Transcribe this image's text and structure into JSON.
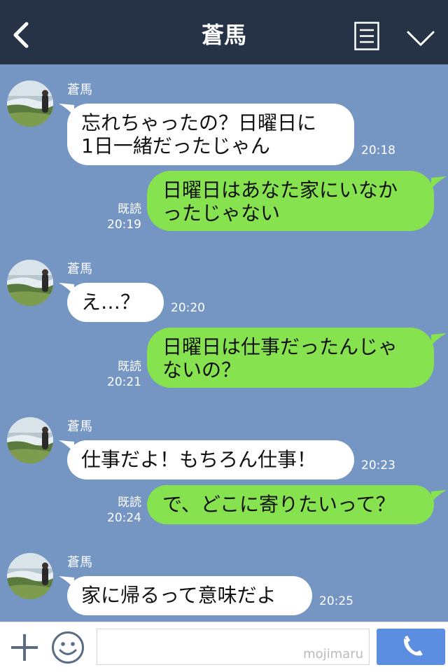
{
  "header": {
    "title": "蒼馬"
  },
  "messages": [
    {
      "side": "in",
      "name": "蒼馬",
      "lines": [
        "忘れちゃったの？日曜日に",
        "1日一緒だったじゃん"
      ],
      "time": "20:18"
    },
    {
      "side": "out",
      "read": "既読",
      "lines": [
        "日曜日はあなた家にいなか",
        "ったじゃない"
      ],
      "time": "20:19"
    },
    {
      "side": "in",
      "name": "蒼馬",
      "lines": [
        "え…？"
      ],
      "time": "20:20"
    },
    {
      "side": "out",
      "read": "既読",
      "lines": [
        "日曜日は仕事だったんじゃ",
        "ないの？"
      ],
      "time": "20:21"
    },
    {
      "side": "in",
      "name": "蒼馬",
      "lines": [
        "仕事だよ！もちろん仕事！"
      ],
      "time": "20:23"
    },
    {
      "side": "out",
      "read": "既読",
      "lines": [
        "で、どこに寄りたいって？"
      ],
      "time": "20:24"
    },
    {
      "side": "in",
      "name": "蒼馬",
      "lines": [
        "家に帰るって意味だよ"
      ],
      "time": "20:25"
    }
  ],
  "footer": {
    "watermark": "mojimaru"
  },
  "icons": {
    "back": "chevron-left-icon",
    "menu": "menu-icon",
    "dropdown": "chevron-down-icon",
    "add": "plus-icon",
    "emoji": "smiley-icon",
    "call": "phone-icon"
  },
  "colors": {
    "header": "#263245",
    "background": "#7595c3",
    "outgoing": "#86e24e",
    "incoming": "#ffffff",
    "call": "#5b8ee0"
  }
}
